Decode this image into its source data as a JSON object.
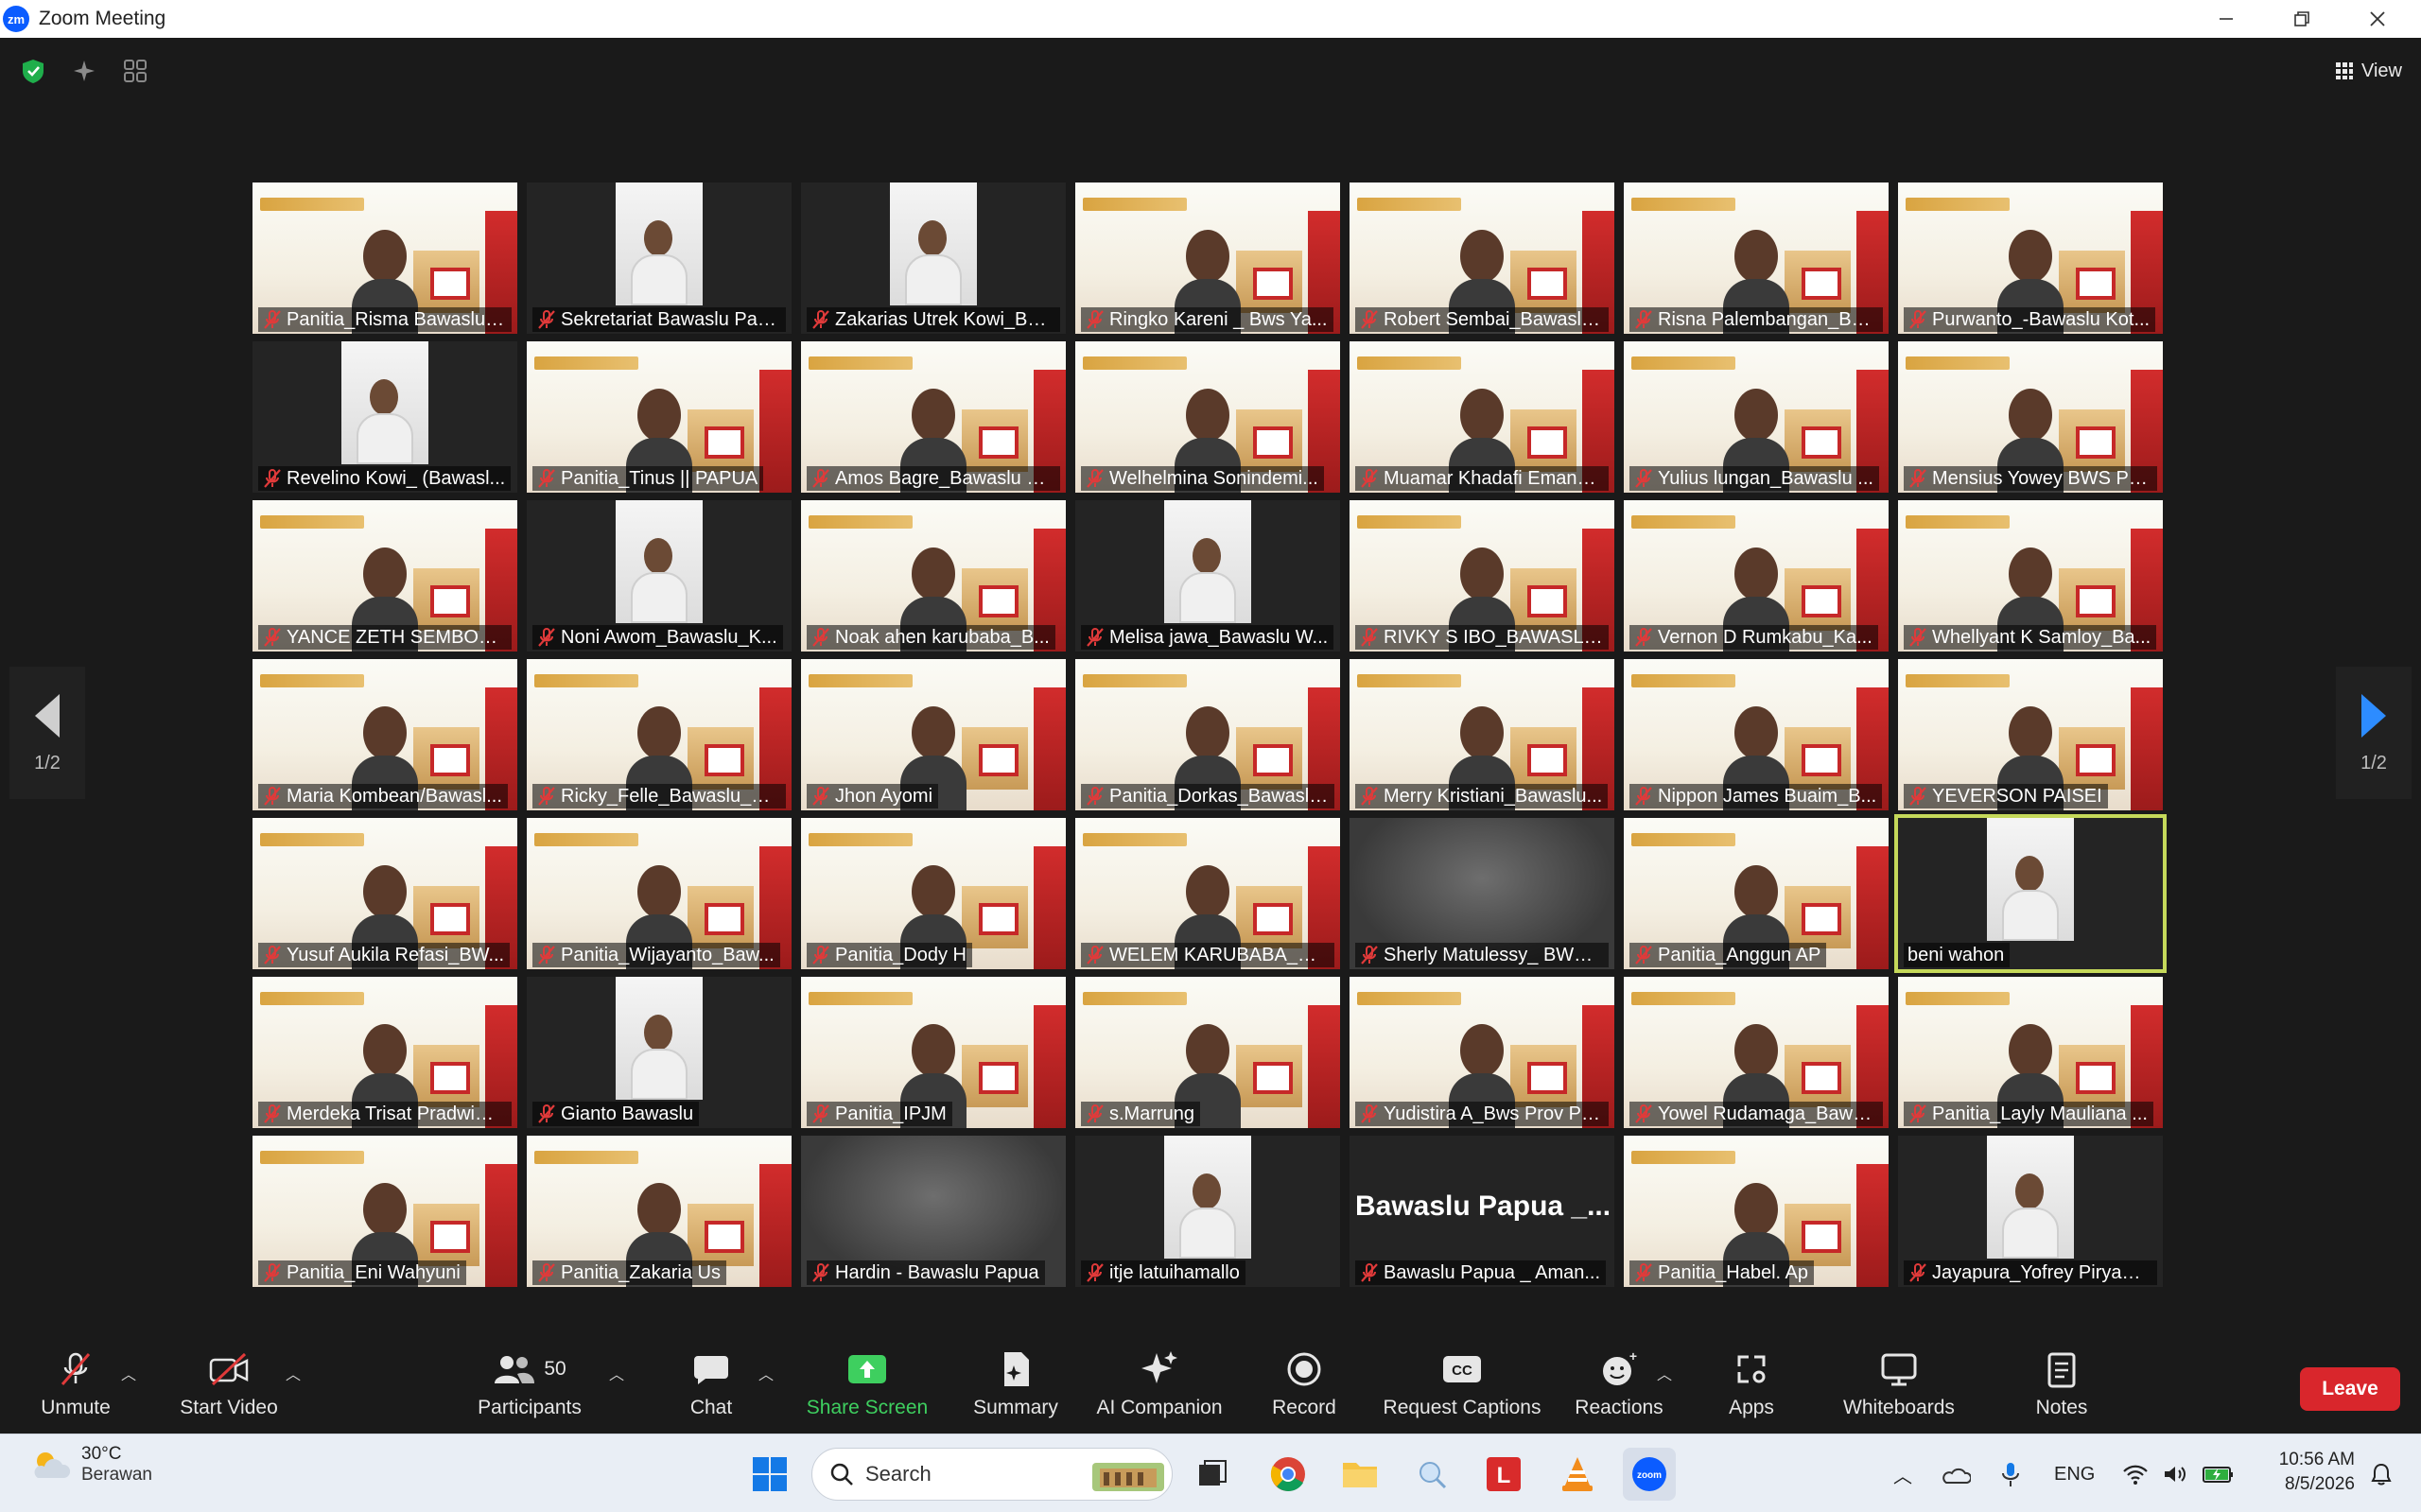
{
  "window": {
    "title": "Zoom Meeting",
    "logo_text": "zm"
  },
  "top": {
    "view_label": "View"
  },
  "pager": {
    "left_label": "1/2",
    "right_label": "1/2"
  },
  "participants": [
    {
      "name": "Panitia_Risma Bawaslu ...",
      "kind": "banner"
    },
    {
      "name": "Sekretariat Bawaslu Pap...",
      "kind": "dark"
    },
    {
      "name": "Zakarias Utrek Kowi_BW...",
      "kind": "dark"
    },
    {
      "name": "Ringko Kareni _ Bws Ya...",
      "kind": "banner"
    },
    {
      "name": "Robert Sembai_Bawaslu...",
      "kind": "banner"
    },
    {
      "name": "Risna Palembangan_Ba...",
      "kind": "banner"
    },
    {
      "name": "Purwanto_-Bawaslu Kot...",
      "kind": "banner"
    },
    {
      "name": "Revelino Kowi_ (Bawasl...",
      "kind": "dark"
    },
    {
      "name": "Panitia_Tinus || PAPUA",
      "kind": "banner"
    },
    {
      "name": "Amos Bagre_Bawaslu K...",
      "kind": "banner"
    },
    {
      "name": "Welhelmina Sonindemi...",
      "kind": "banner"
    },
    {
      "name": "Muamar Khadafi Eman_...",
      "kind": "banner"
    },
    {
      "name": "Yulius lungan_Bawaslu ...",
      "kind": "banner"
    },
    {
      "name": "Mensius Yowey BWS PR...",
      "kind": "banner"
    },
    {
      "name": "YANCE ZETH SEMBOAR...",
      "kind": "banner"
    },
    {
      "name": "Noni Awom_Bawaslu_K...",
      "kind": "dark"
    },
    {
      "name": "Noak ahen karubaba_B...",
      "kind": "banner"
    },
    {
      "name": "Melisa jawa_Bawaslu W...",
      "kind": "dark"
    },
    {
      "name": "RIVKY S IBO_BAWASLU ...",
      "kind": "banner"
    },
    {
      "name": "Vernon D Rumkabu_Ka...",
      "kind": "banner"
    },
    {
      "name": "Whellyant K Samloy_Ba...",
      "kind": "banner"
    },
    {
      "name": "Maria Kombean/Bawasl...",
      "kind": "banner"
    },
    {
      "name": "Ricky_Felle_Bawaslu_Ka...",
      "kind": "banner"
    },
    {
      "name": "Jhon Ayomi",
      "kind": "banner"
    },
    {
      "name": "Panitia_Dorkas_Bawaslu...",
      "kind": "banner"
    },
    {
      "name": "Merry Kristiani_Bawaslu...",
      "kind": "banner"
    },
    {
      "name": "Nippon James Buaim_B...",
      "kind": "banner"
    },
    {
      "name": "YEVERSON PAISEI",
      "kind": "banner"
    },
    {
      "name": "Yusuf Aukila Refasi_BW...",
      "kind": "banner"
    },
    {
      "name": "Panitia_Wijayanto_Baw...",
      "kind": "banner"
    },
    {
      "name": "Panitia_Dody H",
      "kind": "banner"
    },
    {
      "name": "WELEM KARUBABA_Se...",
      "kind": "banner"
    },
    {
      "name": "Sherly Matulessy_ BWS ...",
      "kind": "blur"
    },
    {
      "name": "Panitia_Anggun AP",
      "kind": "banner"
    },
    {
      "name": "beni wahon",
      "kind": "dark",
      "active": true,
      "muted": false
    },
    {
      "name": "Merdeka Trisat Pradwim...",
      "kind": "banner"
    },
    {
      "name": "Gianto Bawaslu",
      "kind": "dark"
    },
    {
      "name": "Panitia_IPJM",
      "kind": "banner"
    },
    {
      "name": "s.Marrung",
      "kind": "banner"
    },
    {
      "name": "Yudistira A_Bws Prov Pa...",
      "kind": "banner"
    },
    {
      "name": "Yowel Rudamaga_Bawa...",
      "kind": "banner"
    },
    {
      "name": "Panitia_Layly Mauliana ...",
      "kind": "banner"
    },
    {
      "name": "Panitia_Eni Wahyuni",
      "kind": "banner"
    },
    {
      "name": "Panitia_Zakaria Us",
      "kind": "banner"
    },
    {
      "name": "Hardin - Bawaslu Papua",
      "kind": "blur"
    },
    {
      "name": "itje latuihamallo",
      "kind": "dark"
    },
    {
      "name": "Bawaslu Papua _ Aman...",
      "kind": "textonly",
      "big_name": "Bawaslu Papua _..."
    },
    {
      "name": "Panitia_Habel. Ap",
      "kind": "banner"
    },
    {
      "name": "Jayapura_Yofrey Piryamta",
      "kind": "dark"
    }
  ],
  "toolbar": {
    "unmute": "Unmute",
    "start_video": "Start Video",
    "participants": "Participants",
    "participants_count": "50",
    "chat": "Chat",
    "share_screen": "Share Screen",
    "summary": "Summary",
    "ai_companion": "AI Companion",
    "record": "Record",
    "request_captions": "Request Captions",
    "reactions": "Reactions",
    "apps": "Apps",
    "whiteboards": "Whiteboards",
    "notes": "Notes",
    "leave": "Leave"
  },
  "taskbar": {
    "temperature": "30°C",
    "weather": "Berawan",
    "search_placeholder": "Search",
    "language": "ENG",
    "time": "10:56 AM",
    "date": "8/5/2026"
  },
  "colors": {
    "accent": "#0b5cff",
    "share_green": "#3ecf5f",
    "leave_red": "#d9262c",
    "active_speaker": "#c5d95a",
    "mute_red": "#e03a3a"
  }
}
